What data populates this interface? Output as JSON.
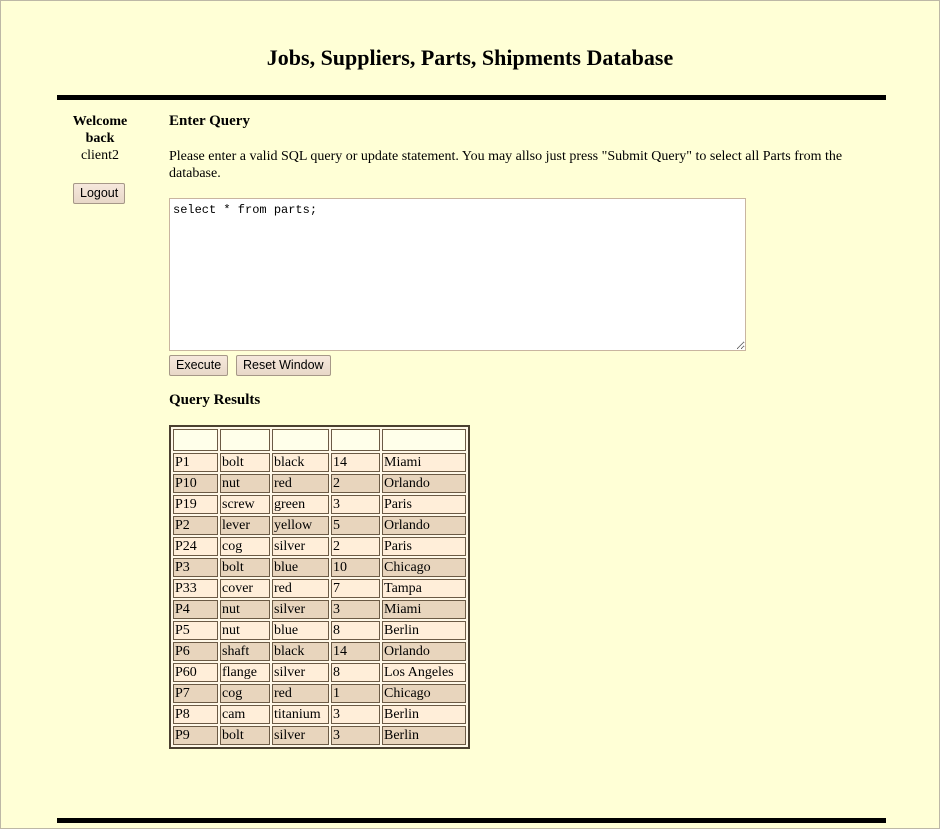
{
  "page": {
    "title": "Jobs, Suppliers, Parts, Shipments Database"
  },
  "sidebar": {
    "welcome": "Welcome back",
    "username": "client2",
    "logout_label": "Logout"
  },
  "query": {
    "heading": "Enter Query",
    "instructions": "Please enter a valid SQL query or update statement. You may allso just press \"Submit Query\" to select all Parts from the database.",
    "value": "select * from parts;",
    "execute_label": "Execute",
    "reset_label": "Reset Window"
  },
  "results": {
    "heading": "Query Results",
    "columns": [
      "",
      "",
      "",
      "",
      ""
    ],
    "rows": [
      [
        "P1",
        "bolt",
        "black",
        "14",
        "Miami"
      ],
      [
        "P10",
        "nut",
        "red",
        "2",
        "Orlando"
      ],
      [
        "P19",
        "screw",
        "green",
        "3",
        "Paris"
      ],
      [
        "P2",
        "lever",
        "yellow",
        "5",
        "Orlando"
      ],
      [
        "P24",
        "cog",
        "silver",
        "2",
        "Paris"
      ],
      [
        "P3",
        "bolt",
        "blue",
        "10",
        "Chicago"
      ],
      [
        "P33",
        "cover",
        "red",
        "7",
        "Tampa"
      ],
      [
        "P4",
        "nut",
        "silver",
        "3",
        "Miami"
      ],
      [
        "P5",
        "nut",
        "blue",
        "8",
        "Berlin"
      ],
      [
        "P6",
        "shaft",
        "black",
        "14",
        "Orlando"
      ],
      [
        "P60",
        "flange",
        "silver",
        "8",
        "Los Angeles"
      ],
      [
        "P7",
        "cog",
        "red",
        "1",
        "Chicago"
      ],
      [
        "P8",
        "cam",
        "titanium",
        "3",
        "Berlin"
      ],
      [
        "P9",
        "bolt",
        "silver",
        "3",
        "Berlin"
      ]
    ]
  },
  "colors": {
    "background": "#ffffd6",
    "row_light": "#ffeed9",
    "row_dark": "#e8d5bd"
  }
}
